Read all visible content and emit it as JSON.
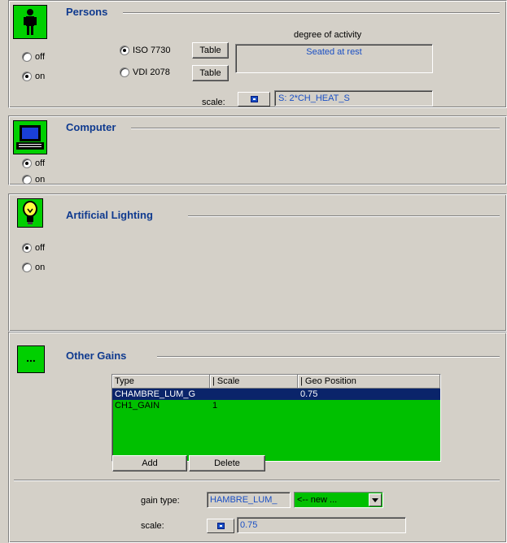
{
  "persons": {
    "title": "Persons",
    "radio_off": "off",
    "radio_on": "on",
    "selected": "on",
    "standard_iso": "ISO 7730",
    "standard_vdi": "VDI 2078",
    "selected_standard": "ISO 7730",
    "table_button": "Table",
    "activity_label": "degree of activity",
    "activity_value": "Seated at rest",
    "scale_label": "scale:",
    "scale_value": "S: 2*CH_HEAT_S"
  },
  "computer": {
    "title": "Computer",
    "radio_off": "off",
    "radio_on": "on",
    "selected": "off"
  },
  "lighting": {
    "title": "Artificial Lighting",
    "radio_off": "off",
    "radio_on": "on",
    "selected": "off"
  },
  "other_gains": {
    "title": "Other Gains",
    "icon_text": "...",
    "columns": [
      "Type",
      "| Scale",
      "| Geo Position"
    ],
    "rows": [
      {
        "type": "CHAMBRE_LUM_G",
        "scale": "",
        "geo": "0.75",
        "selected": true
      },
      {
        "type": "CH1_GAIN",
        "scale": "1",
        "geo": "",
        "selected": false
      }
    ],
    "add_button": "Add",
    "delete_button": "Delete",
    "gain_type_label": "gain type:",
    "gain_type_value": "HAMBRE_LUM_",
    "combo_value": "<-- new ...",
    "scale_label": "scale:",
    "scale_value": "0.75"
  },
  "colors": {
    "accent_green": "#00c000",
    "title_blue": "#0f3a8f",
    "selection": "#0a246a"
  }
}
